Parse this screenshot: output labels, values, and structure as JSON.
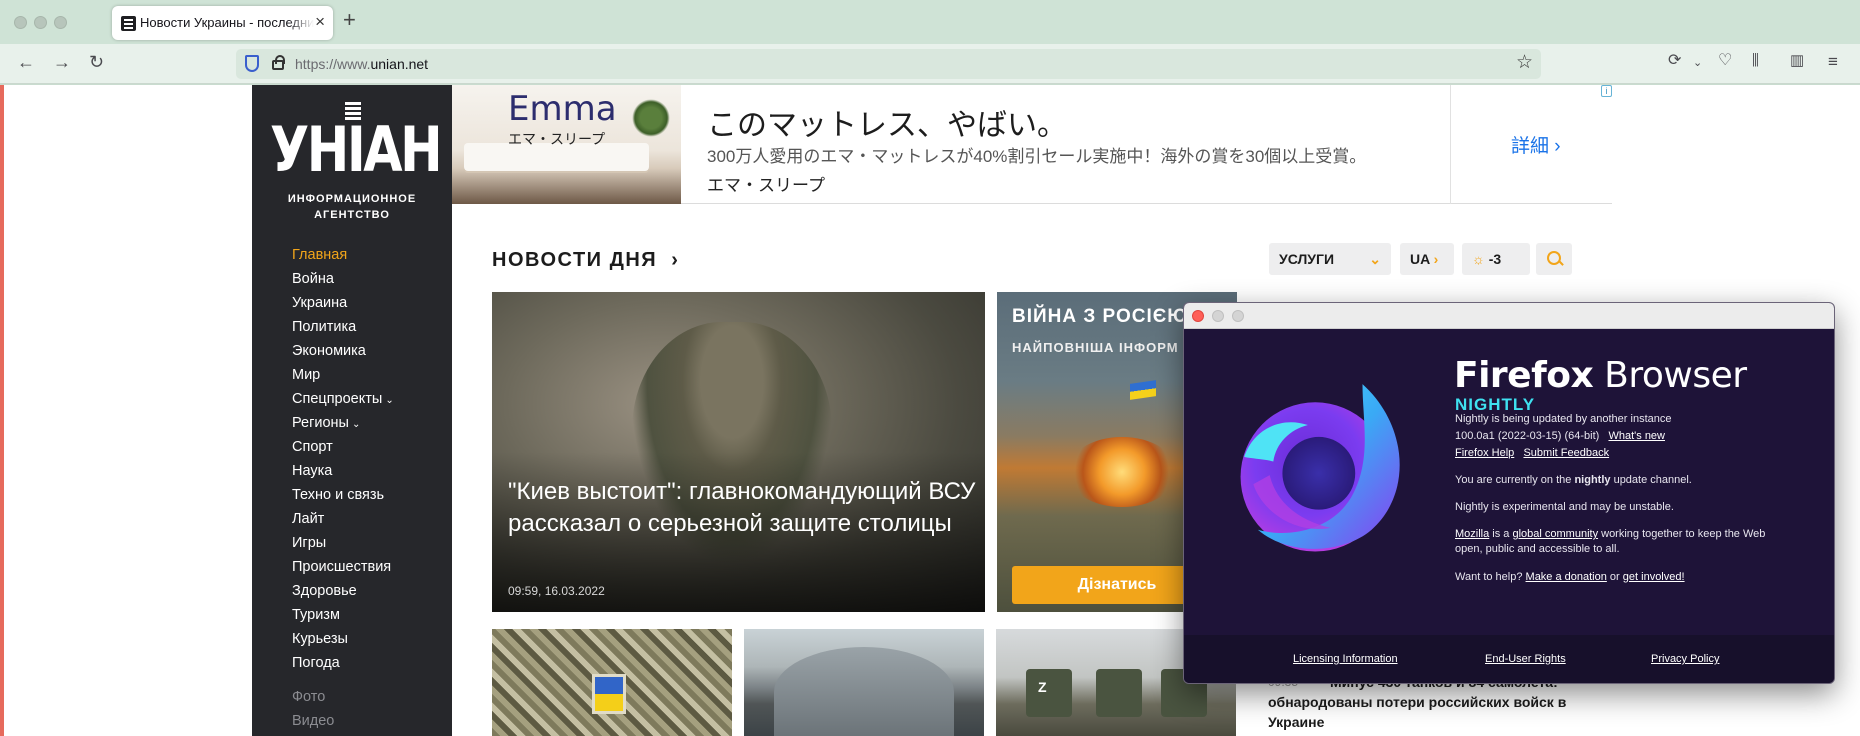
{
  "browser": {
    "tab_title": "Новости Украины - последние новости",
    "new_tab_glyph": "+",
    "close_glyph": "×",
    "url_prefix": "https://www.",
    "url_host": "unian.net"
  },
  "sidebar": {
    "logo": "УНІАН",
    "logo_sub_1": "ИНФОРМАЦИОННОЕ",
    "logo_sub_2": "АГЕНТСТВО",
    "items": [
      {
        "label": "Главная"
      },
      {
        "label": "Война"
      },
      {
        "label": "Украина"
      },
      {
        "label": "Политика"
      },
      {
        "label": "Экономика"
      },
      {
        "label": "Мир"
      },
      {
        "label": "Спецпроекты"
      },
      {
        "label": "Регионы"
      },
      {
        "label": "Спорт"
      },
      {
        "label": "Наука"
      },
      {
        "label": "Техно и связь"
      },
      {
        "label": "Лайт"
      },
      {
        "label": "Игры"
      },
      {
        "label": "Происшествия"
      },
      {
        "label": "Здоровье"
      },
      {
        "label": "Туризм"
      },
      {
        "label": "Курьезы"
      },
      {
        "label": "Погода"
      }
    ],
    "secondary": [
      {
        "label": "Фото"
      },
      {
        "label": "Видео"
      }
    ]
  },
  "ad": {
    "brand": "Emma",
    "brand_sub": "エマ・スリープ",
    "headline": "このマットレス、やばい。",
    "description": "300万人愛用のエマ・マットレスが40%割引セール実施中！海外の賞を30個以上受賞。",
    "source": "エマ・スリープ",
    "cta": "詳細"
  },
  "header": {
    "section_title": "НОВОСТИ ДНЯ",
    "services": "УСЛУГИ",
    "lang": "UA",
    "weather": "-3"
  },
  "hero": {
    "title": "\"Киев выстоит\": главнокомандующий ВСУ рассказал о серьезной защите столицы",
    "date": "09:59, 16.03.2022"
  },
  "promo": {
    "title": "ВІЙНА З РОСІЄЮ:",
    "subtitle": "НАЙПОВНІША ІНФОРМ",
    "button": "Дізнатись"
  },
  "side_news": {
    "time": "09:35",
    "text": "Минус 430 танков и 84 самолета: обнародованы потери российских войск в Украине"
  },
  "about": {
    "wordmark_bold": "Firefox",
    "wordmark_light": " Browser",
    "edition": "NIGHTLY",
    "update_status": "Nightly is being updated by another instance",
    "version": "100.0a1 (2022-03-15) (64-bit)",
    "whats_new": "What's new",
    "help": "Firefox Help",
    "feedback": "Submit Feedback",
    "channel_pre": "You are currently on the ",
    "channel_name": "nightly",
    "channel_post": " update channel.",
    "experimental": "Nightly is experimental and may be unstable.",
    "mozilla": "Mozilla",
    "community_pre": " is a ",
    "community_link": "global community",
    "community_post": " working together to keep the Web",
    "community_line2": "open, public and accessible to all.",
    "help_pre": "Want to help? ",
    "donate": "Make a donation",
    "help_mid": " or ",
    "involved": "get involved!",
    "footer_links": [
      "Licensing Information",
      "End-User Rights",
      "Privacy Policy"
    ]
  },
  "colors": {
    "accent": "#f2a51a",
    "sidebar_bg": "#26272b",
    "about_bg": "#1e1338",
    "nightly": "#3fe1f0",
    "ad_link": "#1a73e8"
  }
}
